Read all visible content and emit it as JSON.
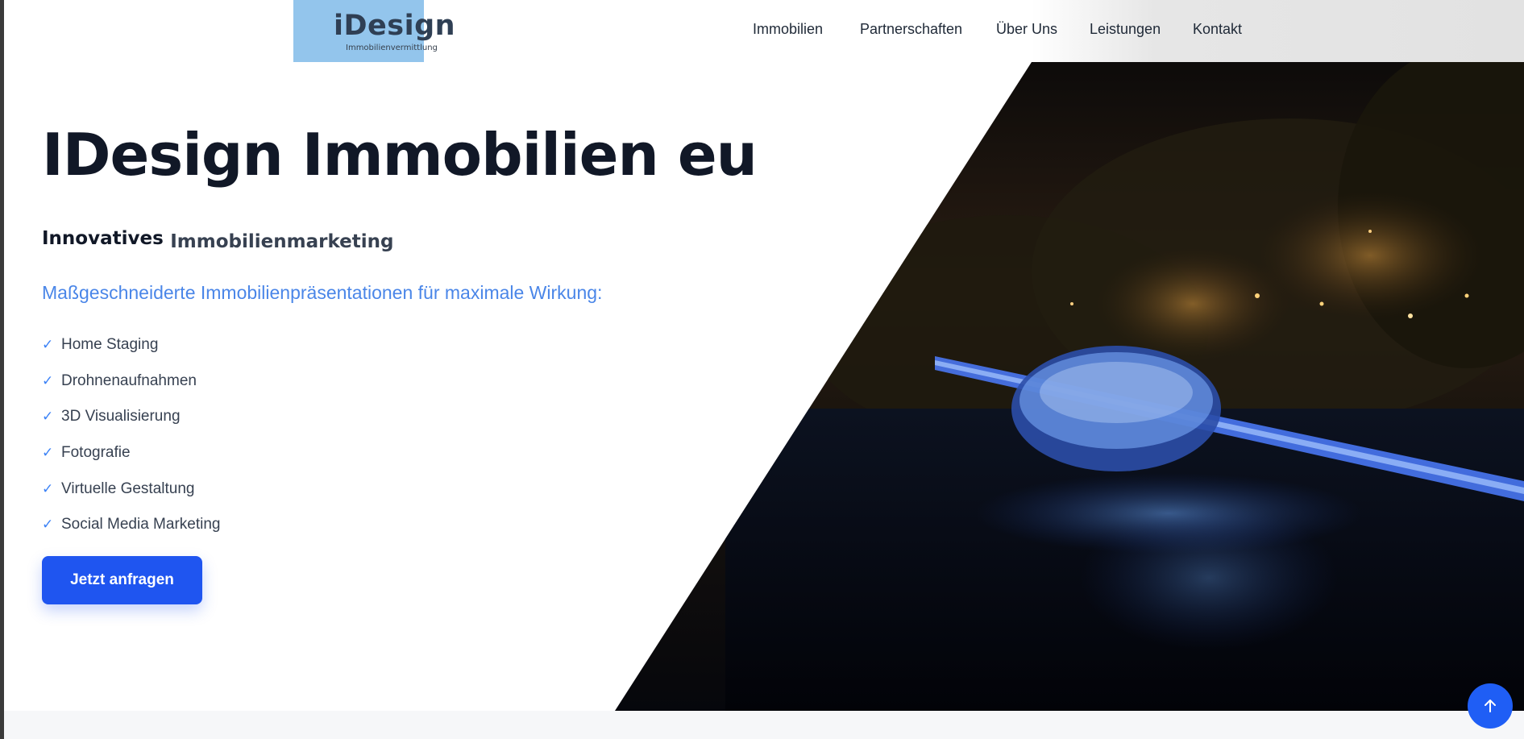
{
  "header": {
    "logo": {
      "title": "iDesign",
      "subtitle": "Immobilienvermittlung"
    },
    "nav": [
      {
        "label": "Immobilien"
      },
      {
        "label": "Partnerschaften"
      },
      {
        "label": "Über Uns"
      },
      {
        "label": "Leistungen"
      },
      {
        "label": "Kontakt"
      }
    ]
  },
  "hero": {
    "title": "IDesign Immobilien eu",
    "subtitle_part1": "Innovatives",
    "subtitle_part2": "Immobilienmarketing",
    "tagline": "Maßgeschneiderte Immobilienpräsentationen für maximale Wirkung:",
    "features": [
      "Home Staging",
      "Drohnenaufnahmen",
      "3D Visualisierung",
      "Fotografie",
      "Virtuelle Gestaltung",
      "Social Media Marketing"
    ],
    "check_symbol": "✓",
    "cta_label": "Jetzt anfragen"
  },
  "icons": {
    "check": "check-icon",
    "scroll_top": "arrow-up-icon"
  },
  "colors": {
    "accent": "#1f55f0",
    "tagline": "#4a86e8",
    "logo_bg": "#93c5ec",
    "heading": "#111827"
  }
}
